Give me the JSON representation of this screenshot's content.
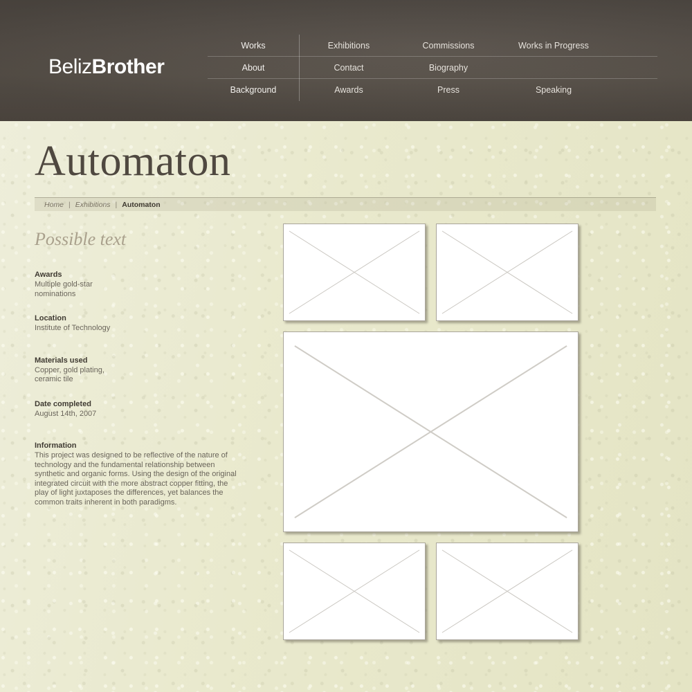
{
  "header": {
    "logo": {
      "light": "Beliz",
      "bold": "Brother"
    },
    "nav_rows": [
      {
        "primary": "Works",
        "items": [
          "Exhibitions",
          "Commissions",
          "Works in Progress"
        ]
      },
      {
        "primary": "About",
        "items": [
          "Contact",
          "Biography",
          ""
        ]
      },
      {
        "primary": "Background",
        "items": [
          "Awards",
          "Press",
          "Speaking"
        ]
      }
    ]
  },
  "title": "Automaton",
  "breadcrumb": {
    "home": "Home",
    "section": "Exhibitions",
    "current": "Automaton",
    "separator": "|"
  },
  "sidebar": {
    "heading": "Possible text",
    "blocks": [
      {
        "label": "Awards",
        "value": "Multiple gold-star\nnominations"
      },
      {
        "label": "Location",
        "value": "Institute of Technology"
      },
      {
        "label": "Materials used",
        "value": "Copper, gold plating,\nceramic tile"
      },
      {
        "label": "Date completed",
        "value": "August 14th, 2007"
      }
    ],
    "information": {
      "label": "Information",
      "body": "This project was designed to be reflective of the nature of technology and the fundamental relationship between synthetic and organic forms. Using the design of the original integrated circuit with the more abstract copper fitting, the play of light juxtaposes the differences, yet balances the common traits inherent in both paradigms."
    }
  },
  "gallery": {
    "rows": [
      {
        "size": "small",
        "items": [
          {
            "name": "image-placeholder-1"
          },
          {
            "name": "image-placeholder-2"
          }
        ]
      },
      {
        "size": "large",
        "items": [
          {
            "name": "image-placeholder-3"
          }
        ]
      },
      {
        "size": "small",
        "items": [
          {
            "name": "image-placeholder-4"
          },
          {
            "name": "image-placeholder-5"
          }
        ]
      }
    ]
  },
  "colors": {
    "header_bg": "#534c45",
    "page_bg": "#e9e9cd",
    "title_text": "#4f4840",
    "heading_accent": "#a9a08c",
    "label_text": "#3f3a32",
    "body_text": "#6a655b",
    "placeholder_border": "#a9a59a"
  }
}
